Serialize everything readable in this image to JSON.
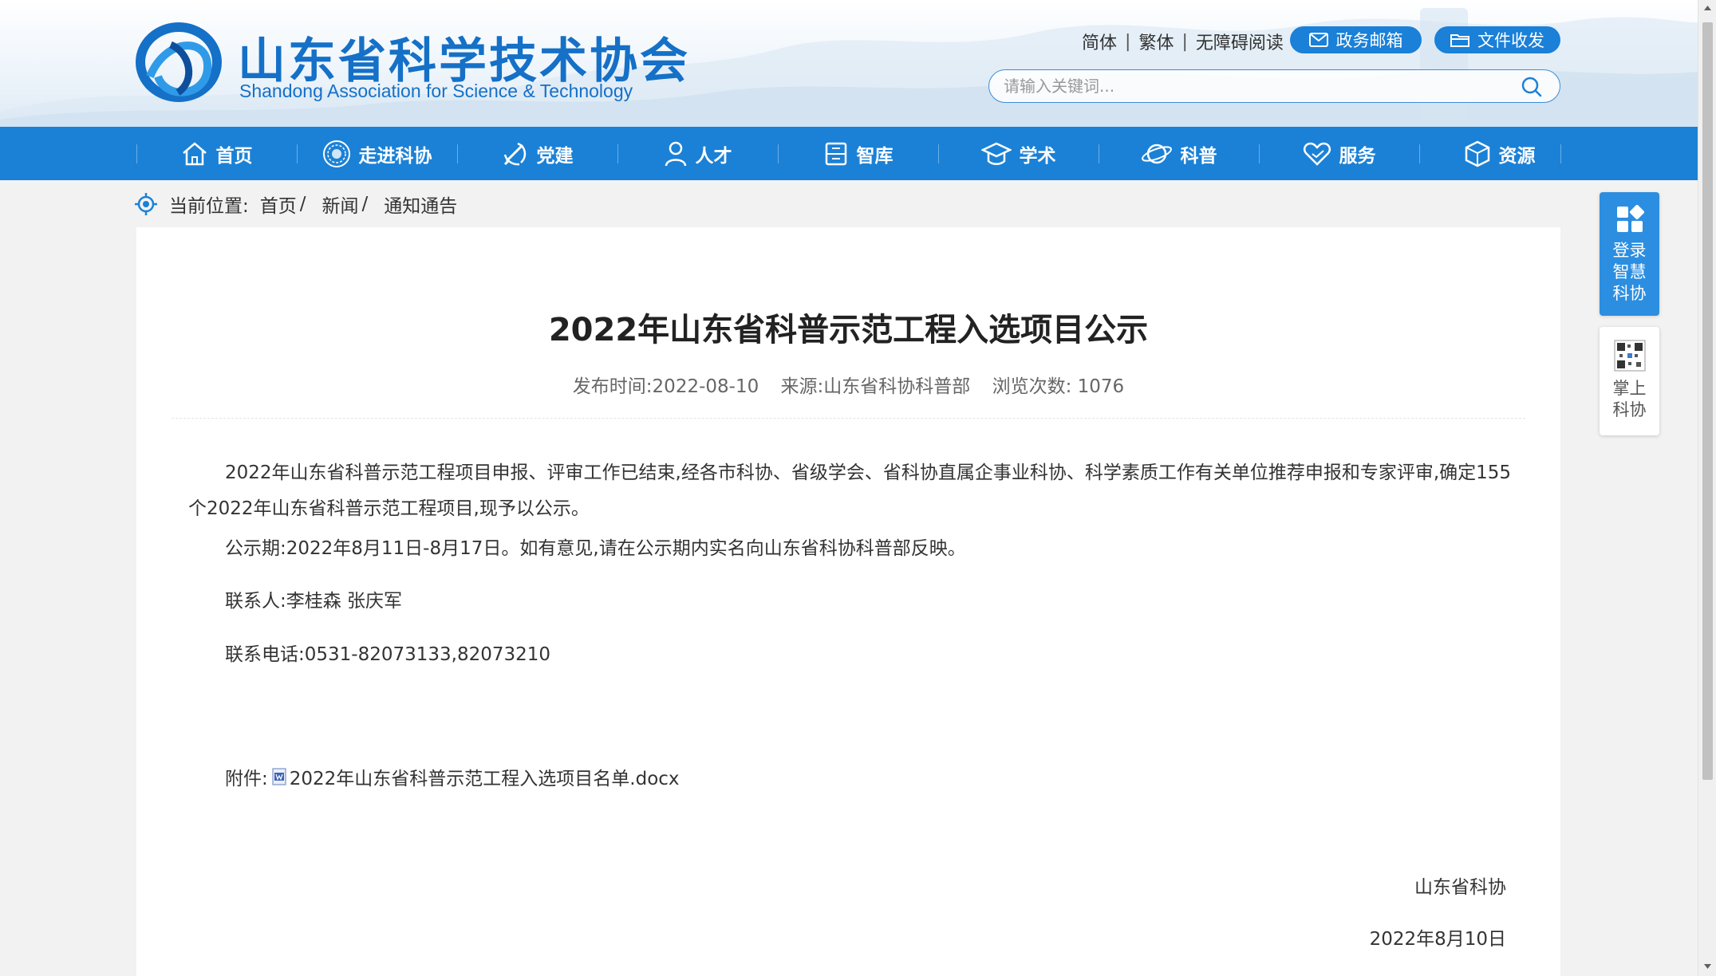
{
  "header": {
    "site_title": "山东省科学技术协会",
    "site_subtitle": "Shandong Association for Science & Technology",
    "top_links": [
      "简体",
      "繁体",
      "无障碍阅读"
    ],
    "mail_button": "政务邮箱",
    "file_button": "文件收发",
    "search_placeholder": "请输入关键词..."
  },
  "nav": {
    "items": [
      {
        "label": "首页",
        "icon": "home-icon"
      },
      {
        "label": "走进科协",
        "icon": "emblem-icon"
      },
      {
        "label": "党建",
        "icon": "party-emblem-icon"
      },
      {
        "label": "人才",
        "icon": "person-icon"
      },
      {
        "label": "智库",
        "icon": "archive-icon"
      },
      {
        "label": "学术",
        "icon": "graduation-cap-icon"
      },
      {
        "label": "科普",
        "icon": "planet-icon"
      },
      {
        "label": "服务",
        "icon": "heart-hand-icon"
      },
      {
        "label": "资源",
        "icon": "cube-icon"
      }
    ]
  },
  "breadcrumb": {
    "prefix": "当前位置:",
    "items": [
      "首页",
      "新闻",
      "通知通告"
    ]
  },
  "article": {
    "title": "2022年山东省科普示范工程入选项目公示",
    "meta": {
      "publish": "发布时间:2022-08-10",
      "source": "来源:山东省科协科普部",
      "views": "浏览次数: 1076"
    },
    "paragraphs": [
      "2022年山东省科普示范工程项目申报、评审工作已结束,经各市科协、省级学会、省科协直属企事业科协、科学素质工作有关单位推荐申报和专家评审,确定155个2022年山东省科普示范工程项目,现予以公示。",
      "公示期:2022年8月11日-8月17日。如有意见,请在公示期内实名向山东省科协科普部反映。",
      "联系人:李桂森 张庆军",
      "联系电话:0531-82073133,82073210"
    ],
    "attachment_label": "附件:",
    "attachment_file": "2022年山东省科普示范工程入选项目名单.docx",
    "signature": "山东省科协",
    "date": "2022年8月10日"
  },
  "floating": {
    "login": "登录智慧科协",
    "mobile": "掌上科协"
  },
  "colors": {
    "brand_blue": "#1b81d6",
    "title_blue": "#1570c7",
    "page_bg": "#f2f2f2"
  }
}
